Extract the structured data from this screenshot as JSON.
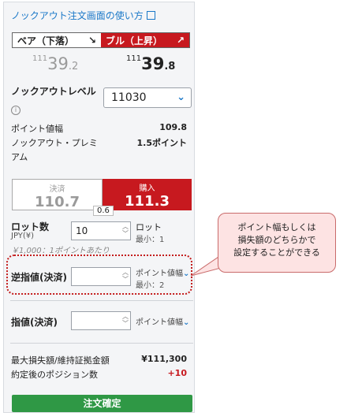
{
  "help_link": "ノックアウト注文画面の使い方",
  "direction_toggle": {
    "bear_label": "ベア（下落）",
    "bear_arrow": "↘",
    "bull_label": "ブル（上昇）",
    "bull_arrow": "↗"
  },
  "prices": {
    "bear": {
      "prefix": "111",
      "main": "39",
      "suffix": ".2"
    },
    "bull": {
      "prefix": "111",
      "main": "39",
      "suffix": ".8"
    }
  },
  "knockout": {
    "label": "ノックアウトレベル",
    "info_icon": "i",
    "selected": "11030"
  },
  "metrics": {
    "point_width_label": "ポイント値幅",
    "point_width_value": "109.8",
    "premium_label_line1": "ノックアウト・プレミ",
    "premium_label_line2": "アム",
    "premium_value": "1.5ポイント"
  },
  "trade": {
    "settle_label": "決済",
    "settle_price": "110.7",
    "buy_label": "購入",
    "buy_price": "111.3",
    "spread": "0.6"
  },
  "lot": {
    "label": "ロット数",
    "currency": "JPY(¥)",
    "value": "10",
    "unit": "ロット",
    "min": "最小：1",
    "note": "￥1,000：1ポイントあたり"
  },
  "stop": {
    "label": "逆指値(決済)",
    "value": "",
    "unit": "ポイント値幅",
    "min": "最小：2"
  },
  "limit": {
    "label": "指値(決済)",
    "value": "",
    "unit": "ポイント値幅"
  },
  "summary": {
    "max_loss_label": "最大損失額/維持証拠金額",
    "max_loss_value": "¥111,300",
    "position_label": "約定後のポジション数",
    "position_value": "+10"
  },
  "confirm_label": "注文確定",
  "callout": {
    "line1": "ポイント幅もしくは",
    "line2": "損失額のどちらかで",
    "line3": "設定することができる"
  },
  "colors": {
    "red": "#c7191f",
    "green": "#2f9845",
    "link_blue": "#1a78c8"
  }
}
